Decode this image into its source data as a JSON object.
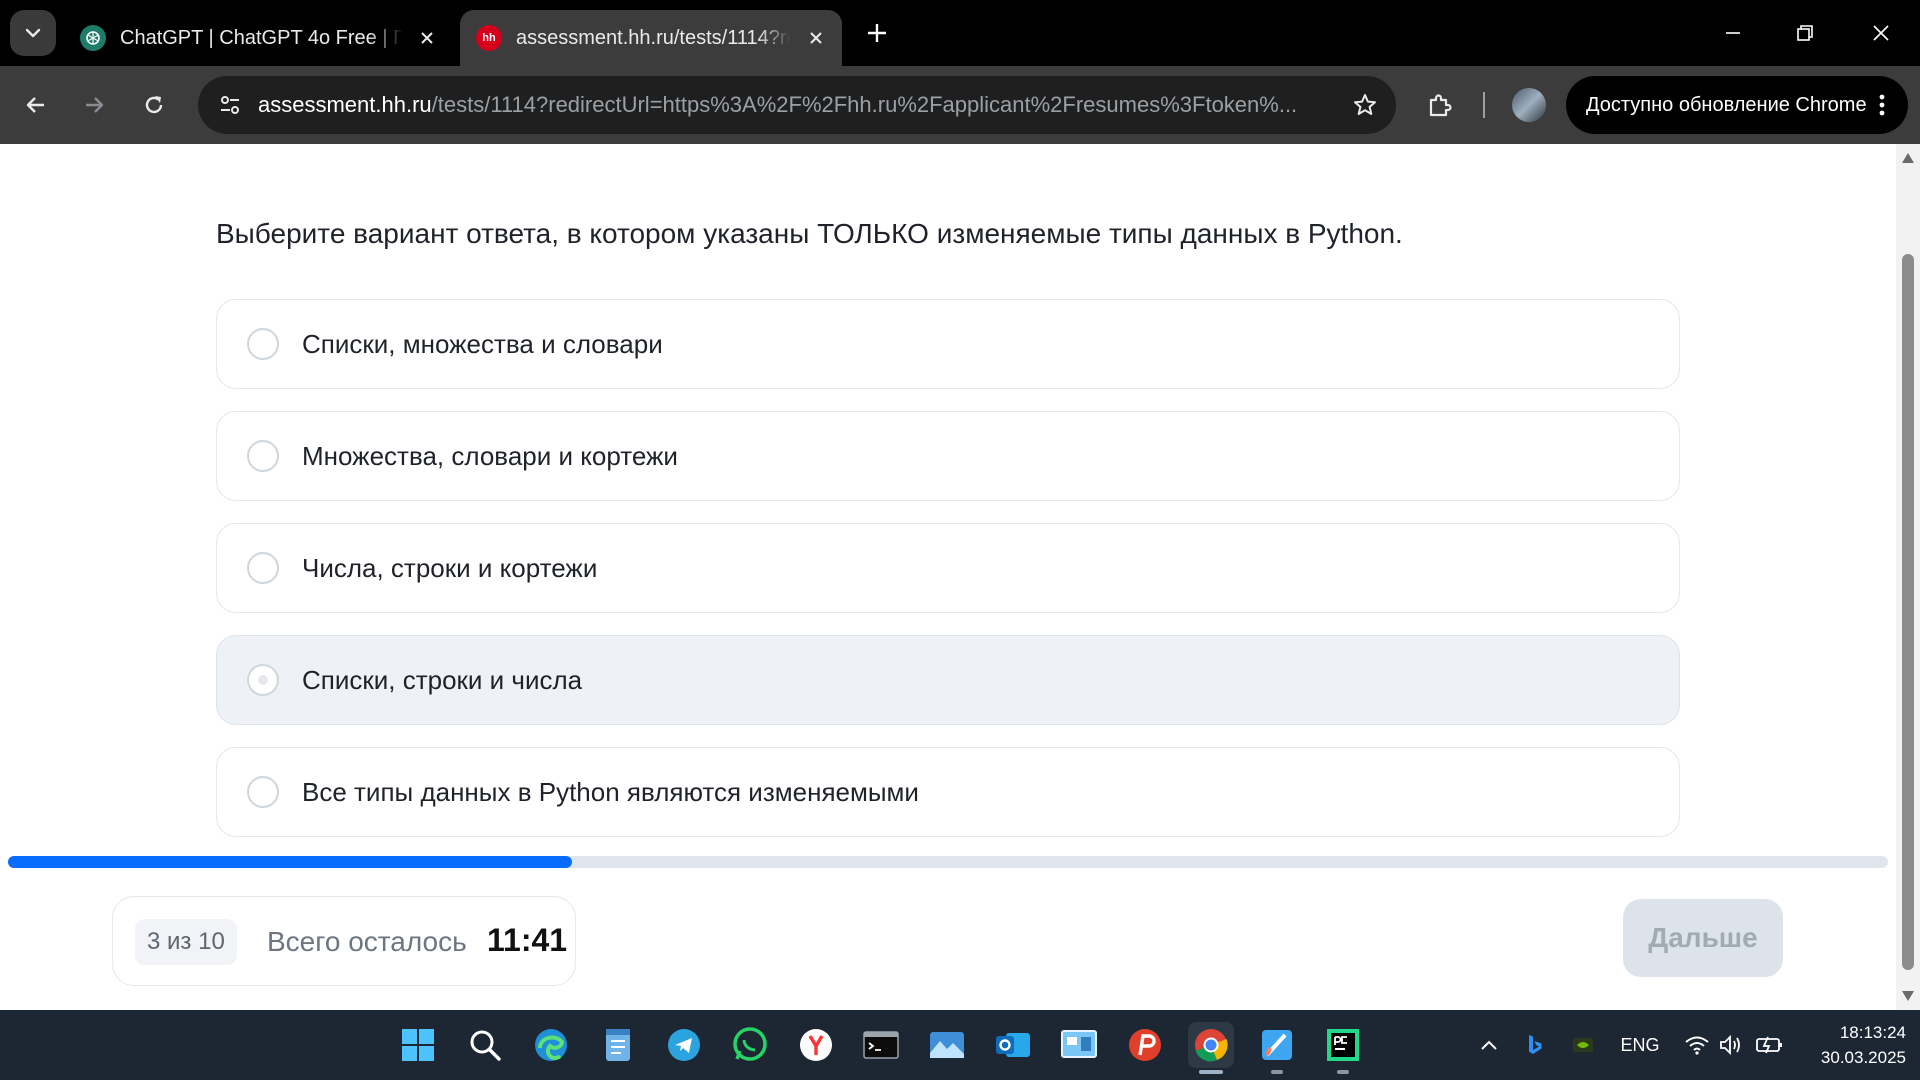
{
  "browser": {
    "tabs": [
      {
        "title": "ChatGPT | ChatGPT 4o Free | По",
        "active": false,
        "favicon": "chatgpt-icon"
      },
      {
        "title": "assessment.hh.ru/tests/1114?re",
        "active": true,
        "favicon": "hh-icon",
        "favicon_text": "hh"
      }
    ],
    "url_host": "assessment.hh.ru",
    "url_path": "/tests/1114?redirectUrl=https%3A%2F%2Fhh.ru%2Fapplicant%2Fresumes%3Ftoken%...",
    "update_label": "Доступно обновление Chrome"
  },
  "quiz": {
    "question": "Выберите вариант ответа, в котором указаны ТОЛЬКО изменяемые типы данных в Python.",
    "options": [
      "Списки, множества и словари",
      "Множества, словари и кортежи",
      "Числа, строки и кортежи",
      "Списки, строки и числа",
      "Все типы данных в Python являются изменяемыми"
    ],
    "hovered_option_index": 3,
    "progress_fraction": 0.3,
    "counter": "3 из 10",
    "remaining_label": "Всего осталось",
    "remaining_time": "11:41",
    "next_label": "Дальше"
  },
  "taskbar": {
    "apps": [
      "start-icon",
      "search-icon",
      "edge-icon",
      "notepad-icon",
      "telegram-icon",
      "whatsapp-icon",
      "yandex-browser-icon",
      "terminal-icon",
      "photos-icon",
      "outlook-icon",
      "control-panel-icon",
      "psiphon-icon",
      "chrome-icon",
      "paint-icon",
      "pycharm-icon"
    ],
    "active_app": "chrome-icon",
    "language": "ENG",
    "time": "18:13:24",
    "date": "30.03.2025"
  },
  "colors": {
    "accent": "#0a6cff",
    "hh_red": "#d6001c",
    "taskbar": "#1c2733"
  }
}
